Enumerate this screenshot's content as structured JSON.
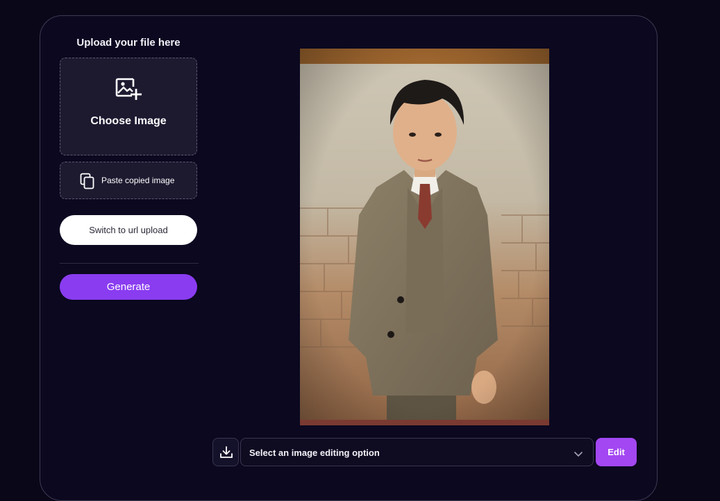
{
  "upload": {
    "title": "Upload your file here",
    "choose_label": "Choose Image",
    "choose_icon": "add-image-icon",
    "paste_label": "Paste copied image",
    "paste_icon": "copy-icon",
    "switch_label": "Switch to url upload",
    "generate_label": "Generate"
  },
  "toolbar": {
    "download_icon": "download-icon",
    "select_placeholder": "Select an image editing option",
    "select_icon": "chevron-down-icon",
    "edit_label": "Edit"
  },
  "preview": {
    "image": "colorized-portrait-photo"
  },
  "colors": {
    "background": "#0a0719",
    "card_border": "#3e3a52",
    "accent": "#8a3cf0",
    "edit_accent": "#a347f2"
  }
}
